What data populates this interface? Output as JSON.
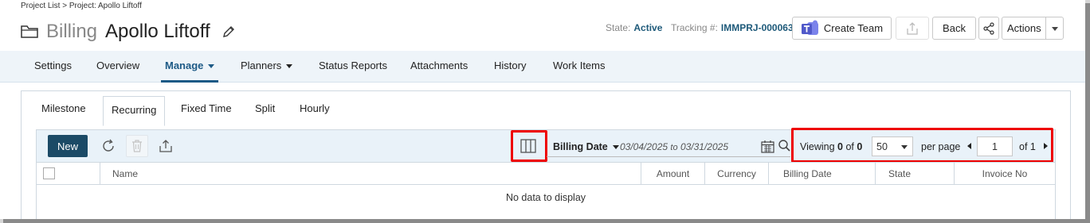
{
  "breadcrumb": "Project List > Project: Apollo Liftoff",
  "title": {
    "kind": "Billing",
    "name": "Apollo Liftoff"
  },
  "meta": {
    "state_label": "State:",
    "state_value": "Active",
    "tracking_label": "Tracking #:",
    "tracking_value": "IMMPRJ-000063"
  },
  "header_buttons": {
    "create_team": "Create Team",
    "back": "Back",
    "actions": "Actions"
  },
  "nav": {
    "items": [
      "Settings",
      "Overview",
      "Manage",
      "Planners",
      "Status Reports",
      "Attachments",
      "History",
      "Work Items"
    ],
    "active": "Manage"
  },
  "subtabs": {
    "items": [
      "Milestone",
      "Recurring",
      "Fixed Time",
      "Split",
      "Hourly"
    ],
    "active": "Recurring"
  },
  "toolbar": {
    "new_label": "New",
    "filter_label": "Billing Date",
    "date_from": "03/04/2025",
    "date_to_word": "to",
    "date_to": "03/31/2025"
  },
  "paging": {
    "viewing_label": "Viewing",
    "viewing_from": "0",
    "of_word": "of",
    "viewing_total": "0",
    "per_page_value": "50",
    "per_page_label": "per page",
    "page_value": "1",
    "page_of_label": "of 1"
  },
  "columns": [
    "Name",
    "Amount",
    "Currency",
    "Billing Date",
    "State",
    "Invoice No"
  ],
  "empty_message": "No data to display",
  "colors": {
    "accent": "#1d5a86",
    "new_button": "#1b4a66",
    "highlight": "#ee0000",
    "teams": "#5059c9"
  },
  "icons": [
    "folder-icon",
    "pencil-icon",
    "teams-icon",
    "share-upload-icon",
    "share-icon",
    "refresh-icon",
    "trash-icon",
    "export-icon",
    "columns-icon",
    "calendar-icon",
    "search-icon"
  ]
}
